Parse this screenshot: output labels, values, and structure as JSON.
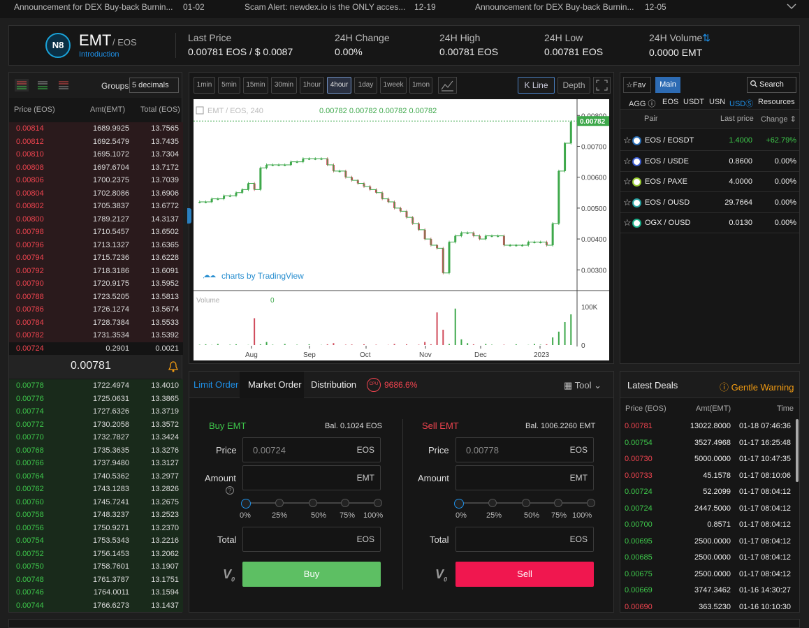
{
  "announcements": [
    {
      "text": "Announcement for DEX Buy-back Burnin...",
      "date": "01-02"
    },
    {
      "text": "Scam Alert: newdex.io is the ONLY acces...",
      "date": "12-19"
    },
    {
      "text": "Announcement for DEX Buy-back Burnin...",
      "date": "12-05"
    }
  ],
  "header": {
    "symbol": "EMT",
    "quote": "/ EOS",
    "intro": "Introduction",
    "logo": "N8",
    "last_price_label": "Last Price",
    "last_price": "0.00781  EOS / $ 0.0087",
    "change_label": "24H Change",
    "change": "0.00%",
    "high_label": "24H High",
    "high": "0.00781  EOS",
    "low_label": "24H Low",
    "low": "0.00781  EOS",
    "volume_label": "24H Volume",
    "volume": "0.0000  EMT"
  },
  "orderbook": {
    "groups_label": "Groups",
    "groups_value": "5 decimals",
    "col_price": "Price (EOS)",
    "col_amt": "Amt(EMT)",
    "col_total": "Total (EOS)",
    "asks": [
      [
        "0.00814",
        "1689.9925",
        "13.7565"
      ],
      [
        "0.00812",
        "1692.5479",
        "13.7435"
      ],
      [
        "0.00810",
        "1695.1072",
        "13.7304"
      ],
      [
        "0.00808",
        "1697.6704",
        "13.7172"
      ],
      [
        "0.00806",
        "1700.2375",
        "13.7039"
      ],
      [
        "0.00804",
        "1702.8086",
        "13.6906"
      ],
      [
        "0.00802",
        "1705.3837",
        "13.6772"
      ],
      [
        "0.00800",
        "1789.2127",
        "14.3137"
      ],
      [
        "0.00798",
        "1710.5457",
        "13.6502"
      ],
      [
        "0.00796",
        "1713.1327",
        "13.6365"
      ],
      [
        "0.00794",
        "1715.7236",
        "13.6228"
      ],
      [
        "0.00792",
        "1718.3186",
        "13.6091"
      ],
      [
        "0.00790",
        "1720.9175",
        "13.5952"
      ],
      [
        "0.00788",
        "1723.5205",
        "13.5813"
      ],
      [
        "0.00786",
        "1726.1274",
        "13.5674"
      ],
      [
        "0.00784",
        "1728.7384",
        "13.5533"
      ],
      [
        "0.00782",
        "1731.3534",
        "13.5392"
      ],
      [
        "0.00724",
        "0.2901",
        "0.0021"
      ]
    ],
    "mid_price": "0.00781",
    "bids": [
      [
        "0.00778",
        "1722.4974",
        "13.4010"
      ],
      [
        "0.00776",
        "1725.0631",
        "13.3865"
      ],
      [
        "0.00774",
        "1727.6326",
        "13.3719"
      ],
      [
        "0.00772",
        "1730.2058",
        "13.3572"
      ],
      [
        "0.00770",
        "1732.7827",
        "13.3424"
      ],
      [
        "0.00768",
        "1735.3635",
        "13.3276"
      ],
      [
        "0.00766",
        "1737.9480",
        "13.3127"
      ],
      [
        "0.00764",
        "1740.5362",
        "13.2977"
      ],
      [
        "0.00762",
        "1743.1283",
        "13.2826"
      ],
      [
        "0.00760",
        "1745.7241",
        "13.2675"
      ],
      [
        "0.00758",
        "1748.3237",
        "13.2523"
      ],
      [
        "0.00756",
        "1750.9271",
        "13.2370"
      ],
      [
        "0.00754",
        "1753.5343",
        "13.2216"
      ],
      [
        "0.00752",
        "1756.1453",
        "13.2062"
      ],
      [
        "0.00750",
        "1758.7601",
        "13.1907"
      ],
      [
        "0.00748",
        "1761.3787",
        "13.1751"
      ],
      [
        "0.00746",
        "1764.0011",
        "13.1594"
      ],
      [
        "0.00744",
        "1766.6273",
        "13.1437"
      ]
    ]
  },
  "chart_toolbar": {
    "intervals": [
      "1min",
      "5min",
      "15min",
      "30min",
      "1hour",
      "4hour",
      "1day",
      "1week",
      "1mon"
    ],
    "active": "4hour",
    "kline": "K Line",
    "depth": "Depth"
  },
  "chart": {
    "legend": "EMT / EOS, 240",
    "ohlc": "0.00782  0.00782  0.00782  0.00782",
    "watermark": "charts by TradingView",
    "volume_label": "Volume",
    "volume_value": "0",
    "current_price": "0.00782"
  },
  "chart_data": {
    "type": "candlestick",
    "x_ticks": [
      "Aug",
      "Sep",
      "Oct",
      "Nov",
      "Dec",
      "2023"
    ],
    "y_ticks": [
      "0.00800",
      "0.00700",
      "0.00600",
      "0.00500",
      "0.00400",
      "0.00300"
    ],
    "vol_ticks": [
      "100K",
      "0"
    ],
    "close": [
      0.0052,
      0.0052,
      0.0053,
      0.0053,
      0.0054,
      0.0054,
      0.0055,
      0.0056,
      0.0058,
      0.0056,
      0.0063,
      0.0064,
      0.0064,
      0.0064,
      0.0064,
      0.0065,
      0.0065,
      0.0066,
      0.0066,
      0.0066,
      0.0066,
      0.0064,
      0.0062,
      0.0062,
      0.006,
      0.0059,
      0.0058,
      0.0057,
      0.0056,
      0.0055,
      0.0053,
      0.0052,
      0.005,
      0.0049,
      0.0047,
      0.0045,
      0.0043,
      0.004,
      0.0038,
      0.0037,
      0.0029,
      0.0039,
      0.0041,
      0.0042,
      0.0042,
      0.0041,
      0.004,
      0.0041,
      0.0041,
      0.0041,
      0.0038,
      0.0038,
      0.0038,
      0.0038,
      0.0039,
      0.0039,
      0.0039,
      0.0038,
      0.0045,
      0.0062,
      0.0071,
      0.0078
    ],
    "volume": [
      1000,
      2000,
      500,
      3000,
      0,
      1000,
      2000,
      0,
      500,
      70000,
      2000,
      8000,
      1000,
      0,
      3000,
      0,
      1000,
      0,
      2000,
      0,
      500,
      2000,
      5000,
      0,
      1000,
      1500,
      0,
      2000,
      0,
      1000,
      0,
      500,
      3000,
      0,
      2000,
      0,
      1000,
      8000,
      2000,
      85000,
      40000,
      3000,
      95000,
      15000,
      5000,
      2000,
      0,
      3000,
      1000,
      0,
      1000,
      0,
      2000,
      0,
      500,
      3000,
      1000,
      2000,
      20000,
      35000,
      60000,
      80000
    ]
  },
  "trade": {
    "tabs": [
      "Limit Order",
      "Market Order",
      "Distribution"
    ],
    "cpu_label": "CPU",
    "cpu_value": "9686.6%",
    "tool": "Tool",
    "buy": {
      "title": "Buy EMT",
      "balance": "Bal. 0.1024 EOS",
      "price_label": "Price",
      "price": "0.00724",
      "price_unit": "EOS",
      "amount_label": "Amount",
      "amount_unit": "EMT",
      "total_label": "Total",
      "total_unit": "EOS",
      "button": "Buy"
    },
    "sell": {
      "title": "Sell EMT",
      "balance": "Bal. 1006.2260 EMT",
      "price_label": "Price",
      "price": "0.00778",
      "price_unit": "EOS",
      "amount_label": "Amount",
      "amount_unit": "EMT",
      "total_label": "Total",
      "total_unit": "EOS",
      "button": "Sell"
    },
    "pcts": [
      "0%",
      "25%",
      "50%",
      "75%",
      "100%"
    ]
  },
  "markets": {
    "fav": "Fav",
    "main": "Main",
    "search": "Search",
    "quotes": [
      "AGG",
      "EOS",
      "USDT",
      "USN",
      "USDⓈ",
      "Resources"
    ],
    "active_quote": "USDⓈ",
    "col_pair": "Pair",
    "col_last": "Last price",
    "col_change": "Change",
    "rows": [
      [
        "EOS / EOSDT",
        "1.4000",
        "+62.79%"
      ],
      [
        "EOS / USDE",
        "0.8600",
        "0.00%"
      ],
      [
        "EOS / PAXE",
        "4.0000",
        "0.00%"
      ],
      [
        "EOS / OUSD",
        "29.7664",
        "0.00%"
      ],
      [
        "OGX / OUSD",
        "0.0130",
        "0.00%"
      ]
    ]
  },
  "deals": {
    "title": "Latest Deals",
    "warning": "Gentle Warning",
    "col_price": "Price (EOS)",
    "col_amt": "Amt(EMT)",
    "col_time": "Time",
    "rows": [
      [
        "0.00781",
        "13022.8000",
        "01-18 07:46:36",
        "r"
      ],
      [
        "0.00754",
        "3527.4968",
        "01-17 16:25:48",
        "g"
      ],
      [
        "0.00730",
        "5000.0000",
        "01-17 10:47:35",
        "r"
      ],
      [
        "0.00733",
        "45.1578",
        "01-17 08:10:06",
        "r"
      ],
      [
        "0.00724",
        "52.2099",
        "01-17 08:04:12",
        "g"
      ],
      [
        "0.00724",
        "2447.5000",
        "01-17 08:04:12",
        "g"
      ],
      [
        "0.00700",
        "0.8571",
        "01-17 08:04:12",
        "g"
      ],
      [
        "0.00695",
        "2500.0000",
        "01-17 08:04:12",
        "g"
      ],
      [
        "0.00685",
        "2500.0000",
        "01-17 08:04:12",
        "g"
      ],
      [
        "0.00675",
        "2500.0000",
        "01-17 08:04:12",
        "g"
      ],
      [
        "0.00669",
        "3747.3462",
        "01-16 14:30:27",
        "g"
      ],
      [
        "0.00690",
        "363.5230",
        "01-16 10:10:30",
        "r"
      ]
    ]
  }
}
